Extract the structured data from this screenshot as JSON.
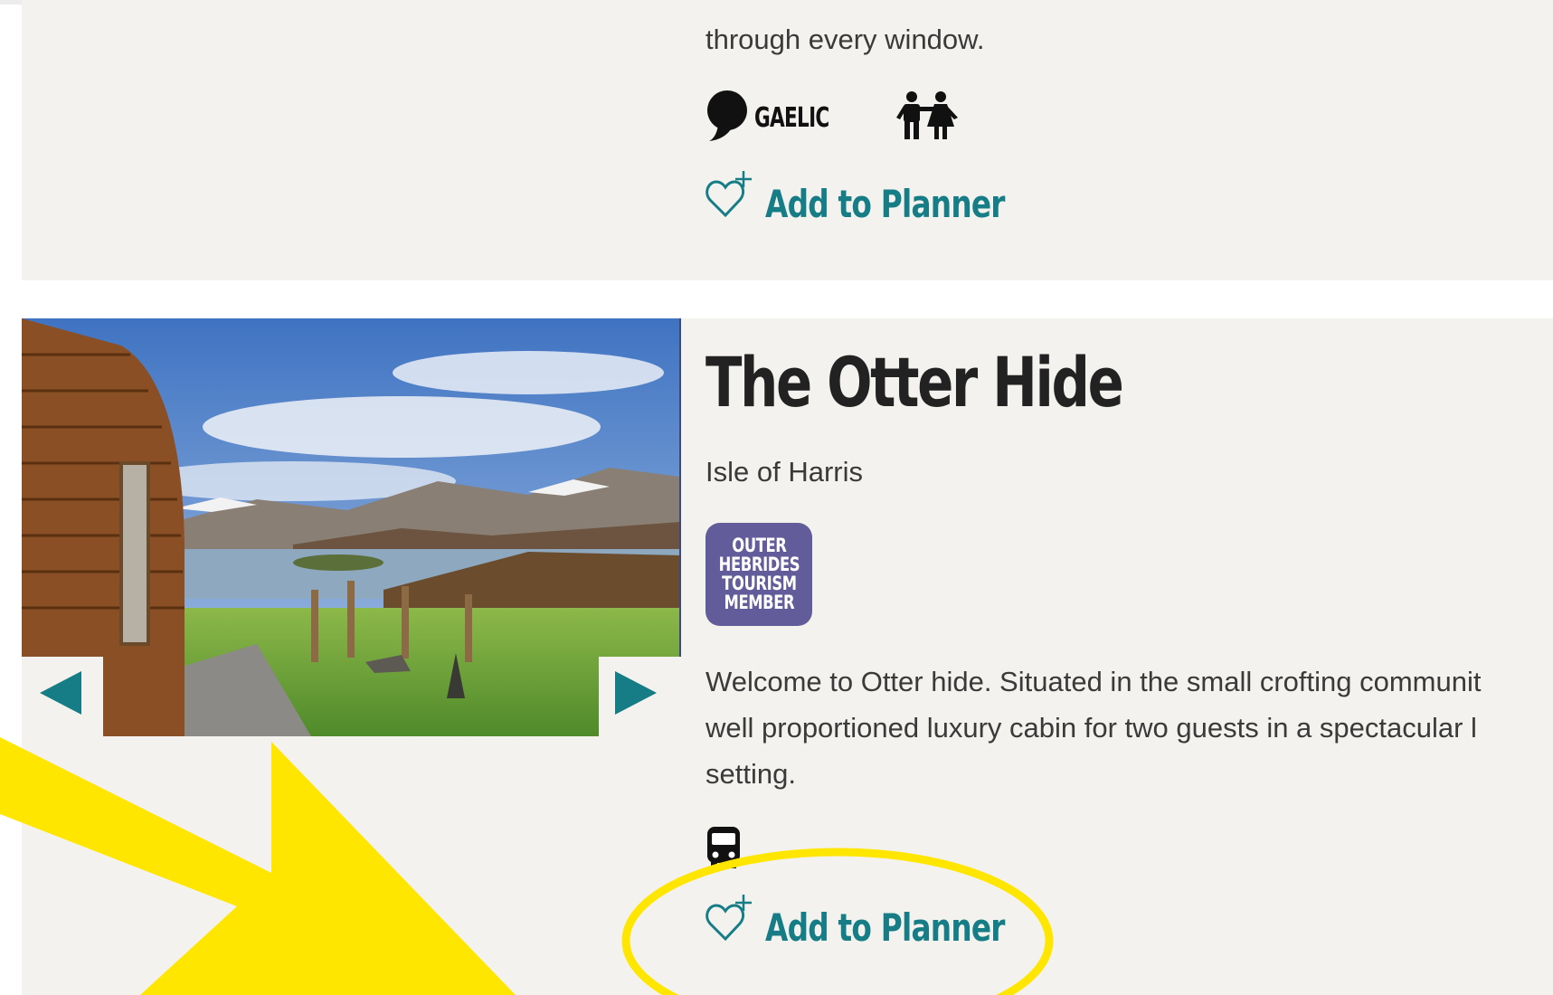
{
  "colors": {
    "accent": "#167d86",
    "card_bg": "#f4f2ee",
    "badge_bg": "#625d9a",
    "highlight": "#ffe600"
  },
  "listing1": {
    "description_tail": "through every window.",
    "features": [
      {
        "icon": "speech-bubble-icon",
        "label": "GAELIC"
      },
      {
        "icon": "family-children-icon",
        "label": ""
      }
    ],
    "planner_label": "Add to Planner"
  },
  "listing2": {
    "title": "The Otter Hide",
    "location": "Isle of Harris",
    "badge": "OUTER\nHEBRIDES\nTOURISM\nMEMBER",
    "description_lines": [
      "Welcome to Otter hide. Situated in the small crofting communit",
      "well proportioned luxury cabin for two guests in a spectacular l",
      "setting."
    ],
    "features": [
      {
        "icon": "bus-icon",
        "label": ""
      }
    ],
    "planner_label": "Add to Planner"
  }
}
